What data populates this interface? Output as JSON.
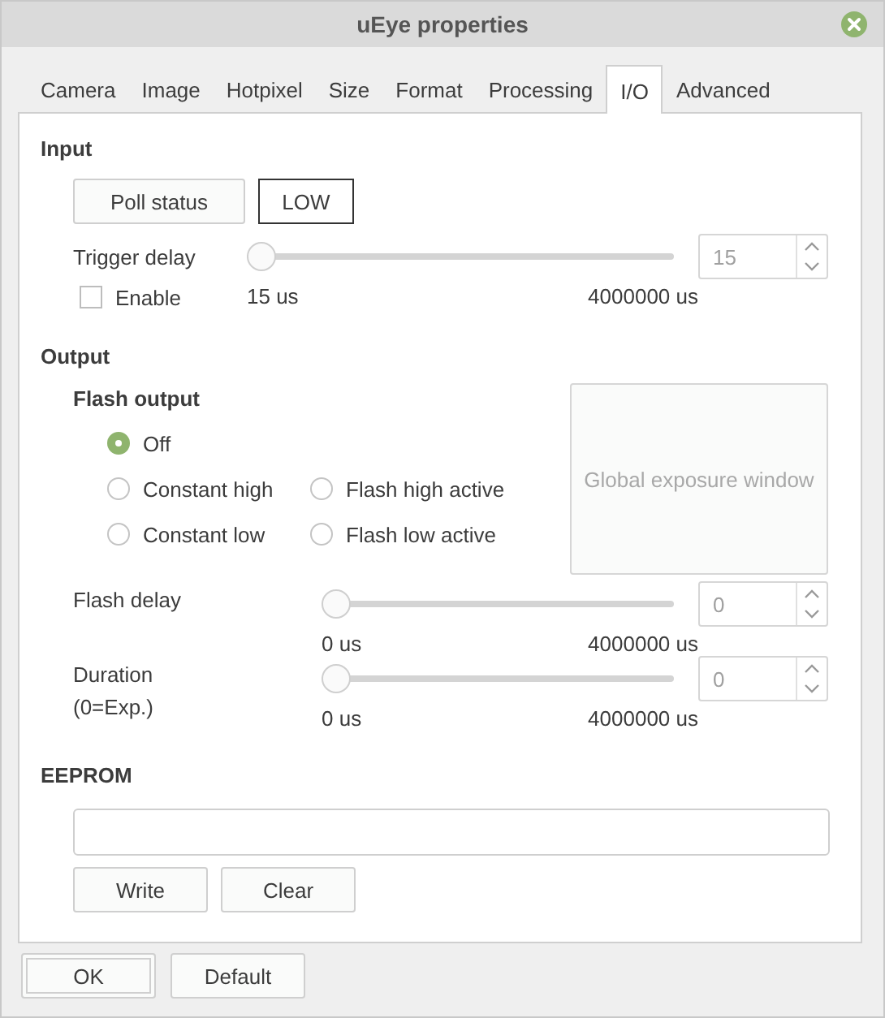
{
  "window": {
    "title": "uEye properties"
  },
  "tabs": [
    {
      "label": "Camera",
      "selected": false
    },
    {
      "label": "Image",
      "selected": false
    },
    {
      "label": "Hotpixel",
      "selected": false
    },
    {
      "label": "Size",
      "selected": false
    },
    {
      "label": "Format",
      "selected": false
    },
    {
      "label": "Processing",
      "selected": false
    },
    {
      "label": "I/O",
      "selected": true
    },
    {
      "label": "Advanced",
      "selected": false
    }
  ],
  "input": {
    "heading": "Input",
    "poll_button": "Poll status",
    "status": "LOW",
    "trigger_delay": {
      "label": "Trigger delay",
      "level": 0,
      "min": "15 us",
      "max": "4000000 us",
      "value": "15",
      "disabled": true
    },
    "enable": {
      "label": "Enable",
      "checked": false
    }
  },
  "output": {
    "heading": "Output",
    "flash_heading": "Flash output",
    "options": [
      {
        "label": "Off",
        "selected": true
      },
      {
        "label": "Constant high",
        "selected": false
      },
      {
        "label": "Flash high active",
        "selected": false
      },
      {
        "label": "Constant low",
        "selected": false
      },
      {
        "label": "Flash low active",
        "selected": false
      }
    ],
    "global_exposure": {
      "label": "Global exposure window",
      "disabled": true
    },
    "sliders": [
      {
        "label": "Flash delay",
        "level": 0,
        "min": "0 us",
        "max": "4000000 us",
        "value": "0",
        "disabled": true
      },
      {
        "label": "Duration\n(0=Exp.)",
        "level": 0,
        "min": "0 us",
        "max": "4000000 us",
        "value": "0",
        "disabled": true
      }
    ]
  },
  "eeprom": {
    "heading": "EEPROM",
    "buttons": [
      {
        "label": "Write"
      },
      {
        "label": "Clear"
      }
    ]
  },
  "footer": [
    {
      "label": "OK",
      "default": true
    },
    {
      "label": "Default",
      "default": false
    }
  ]
}
